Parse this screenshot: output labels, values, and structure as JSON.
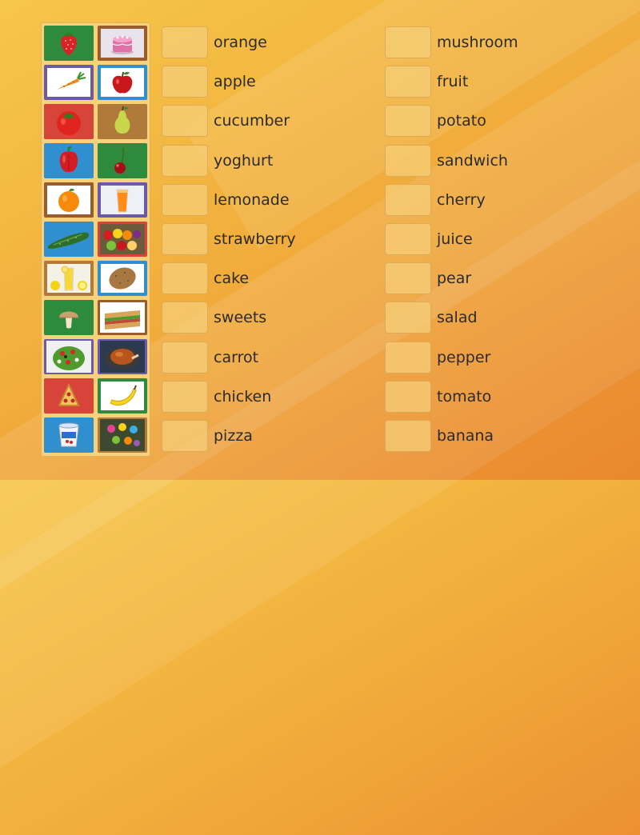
{
  "columns": [
    {
      "words": [
        "orange",
        "apple",
        "cucumber",
        "yoghurt",
        "lemonade",
        "strawberry",
        "cake",
        "sweets",
        "carrot",
        "chicken",
        "pizza"
      ]
    },
    {
      "words": [
        "mushroom",
        "fruit",
        "potato",
        "sandwich",
        "cherry",
        "juice",
        "pear",
        "salad",
        "pepper",
        "tomato",
        "banana"
      ]
    }
  ],
  "tiles": [
    [
      "strawberry-picture",
      "cake-picture"
    ],
    [
      "carrot-picture",
      "apple-picture"
    ],
    [
      "tomato-picture",
      "pear-picture"
    ],
    [
      "pepper-picture",
      "cherry-picture"
    ],
    [
      "orange-picture",
      "juice-picture"
    ],
    [
      "cucumber-picture",
      "fruit-picture"
    ],
    [
      "lemonade-picture",
      "potato-picture"
    ],
    [
      "mushroom-picture",
      "sandwich-picture"
    ],
    [
      "salad-picture",
      "chicken-picture"
    ],
    [
      "pizza-picture",
      "banana-picture"
    ],
    [
      "yoghurt-picture",
      "sweets-picture"
    ]
  ],
  "colors": {
    "background": "#f3b740",
    "tray": "#f8d27b",
    "slot": "#f6cd78",
    "text": "#2b2b2b"
  }
}
